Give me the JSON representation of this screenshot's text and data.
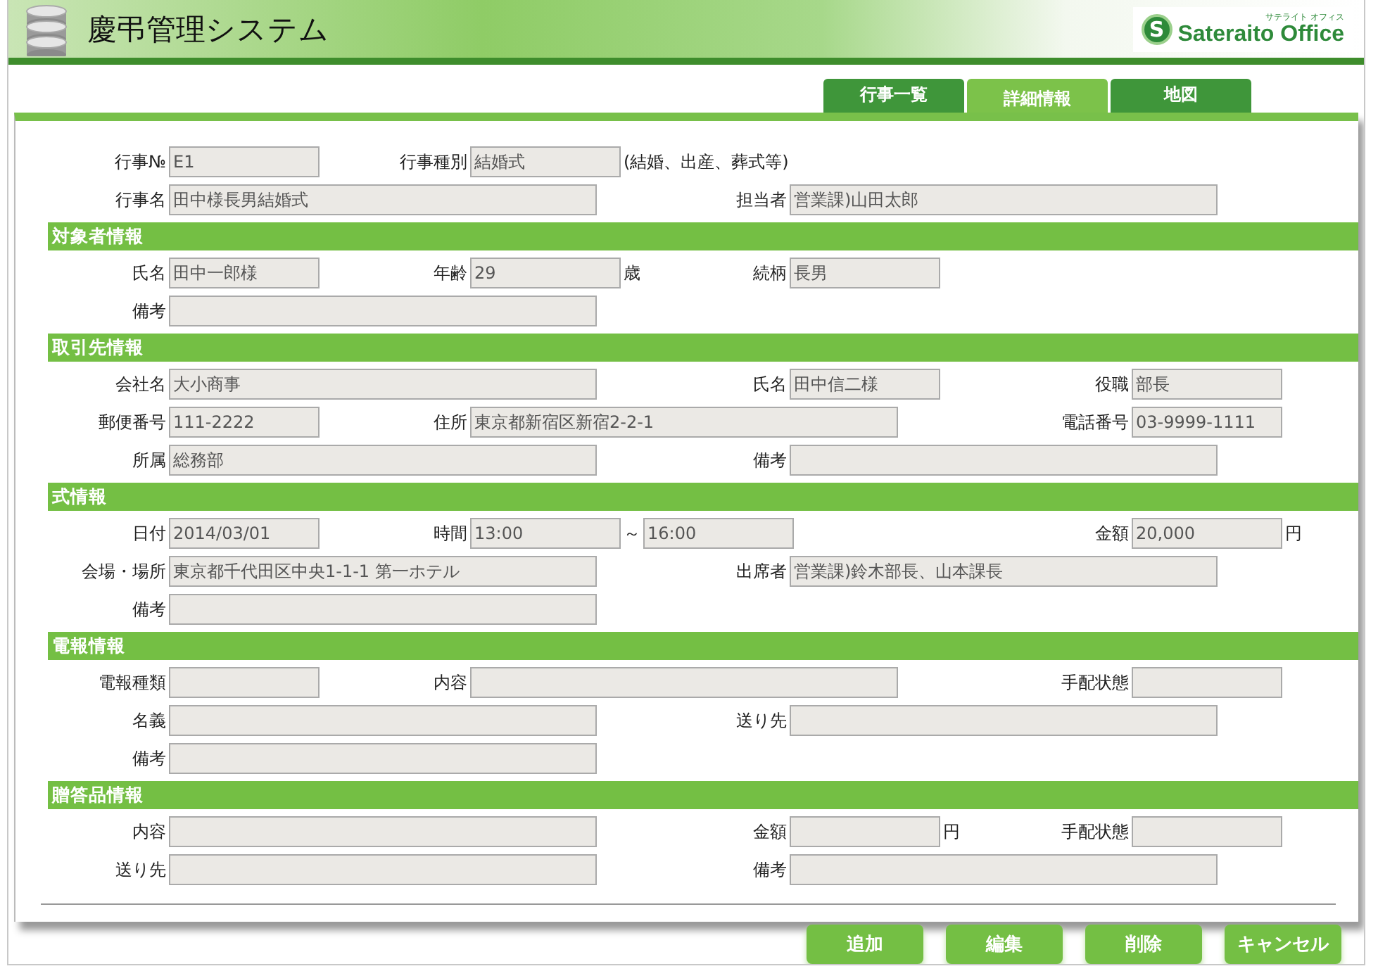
{
  "app": {
    "title": "慶弔管理システム",
    "logo_text": "Sateraito Office",
    "logo_kana": "サテライト オフィス",
    "logo_mark": "S"
  },
  "tabs": [
    {
      "label": "行事一覧",
      "selected": false
    },
    {
      "label": "詳細情報",
      "selected": true
    },
    {
      "label": "地図",
      "selected": false
    }
  ],
  "sections": [
    {
      "rows": [
        [
          {
            "label": "行事№",
            "value": "E1"
          },
          {
            "label": "行事種別",
            "value": "結婚式",
            "suffix": "(結婚、出産、葬式等)"
          }
        ],
        [
          {
            "label": "行事名",
            "value": "田中様長男結婚式"
          },
          {
            "label": "担当者",
            "value": "営業課)山田太郎"
          }
        ]
      ]
    },
    {
      "title": "対象者情報",
      "rows": [
        [
          {
            "label": "氏名",
            "value": "田中一郎様"
          },
          {
            "label": "年齢",
            "value": "29",
            "suffix": "歳"
          },
          {
            "label": "続柄",
            "value": "長男"
          }
        ],
        [
          {
            "label": "備考"
          }
        ]
      ]
    },
    {
      "title": "取引先情報",
      "rows": [
        [
          {
            "label": "会社名",
            "value": "大小商事"
          },
          {
            "label": "氏名",
            "value": "田中信二様"
          },
          {
            "label": "役職",
            "value": "部長"
          }
        ],
        [
          {
            "label": "郵便番号",
            "value": "111-2222"
          },
          {
            "label": "住所",
            "value": "東京都新宿区新宿2-2-1"
          },
          {
            "label": "電話番号",
            "value": "03-9999-1111"
          }
        ],
        [
          {
            "label": "所属",
            "value": "総務部"
          },
          {
            "label": "備考"
          }
        ]
      ]
    },
    {
      "title": "式情報",
      "rows": [
        [
          {
            "label": "日付",
            "value": "2014/03/01"
          },
          {
            "label": "時間",
            "value": "13:00",
            "suffix": "～",
            "value_to": "16:00"
          },
          {
            "label": "金額",
            "value": "20,000",
            "suffix": "円"
          }
        ],
        [
          {
            "label": "会場・場所",
            "value": "東京都千代田区中央1-1-1 第一ホテル"
          },
          {
            "label": "出席者",
            "value": "営業課)鈴木部長、山本課長"
          }
        ],
        [
          {
            "label": "備考"
          }
        ]
      ]
    },
    {
      "title": "電報情報",
      "rows": [
        [
          {
            "label": "電報種類"
          },
          {
            "label": "内容"
          },
          {
            "label": "手配状態"
          }
        ],
        [
          {
            "label": "名義"
          },
          {
            "label": "送り先"
          }
        ],
        [
          {
            "label": "備考"
          }
        ]
      ]
    },
    {
      "title": "贈答品情報",
      "rows": [
        [
          {
            "label": "内容"
          },
          {
            "label": "金額",
            "suffix": "円"
          },
          {
            "label": "手配状態"
          }
        ],
        [
          {
            "label": "送り先"
          },
          {
            "label": "備考"
          }
        ]
      ]
    }
  ],
  "buttons": [
    "追加",
    "編集",
    "削除",
    "キャンセル"
  ]
}
